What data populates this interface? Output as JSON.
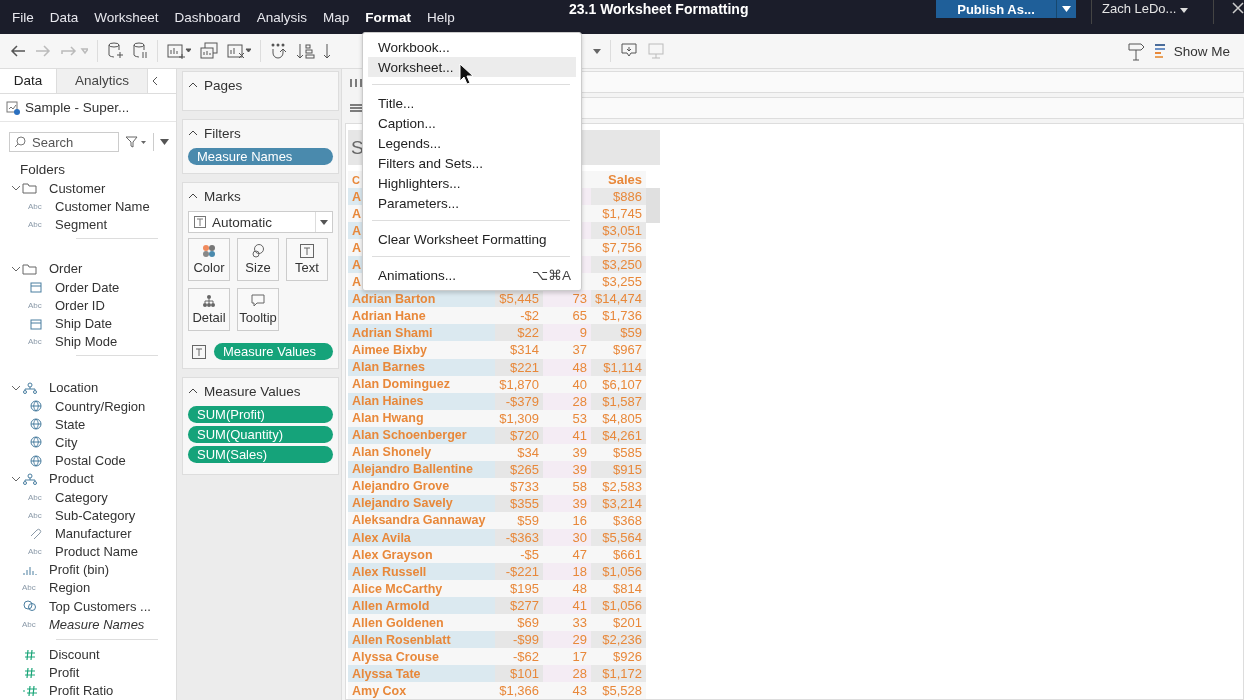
{
  "menu_bar": {
    "items": [
      {
        "label": "File",
        "selected": false
      },
      {
        "label": "Data",
        "selected": false
      },
      {
        "label": "Worksheet",
        "selected": false
      },
      {
        "label": "Dashboard",
        "selected": false
      },
      {
        "label": "Analysis",
        "selected": false
      },
      {
        "label": "Map",
        "selected": false
      },
      {
        "label": "Format",
        "selected": true
      },
      {
        "label": "Help",
        "selected": false
      }
    ],
    "title": "23.1 Worksheet Formatting",
    "publish_button": "Publish As...",
    "user": "Zach LeDo..."
  },
  "toolbar": {
    "show_me": "Show Me"
  },
  "data_pane": {
    "tabs": [
      {
        "label": "Data",
        "selected": true
      },
      {
        "label": "Analytics",
        "selected": false
      }
    ],
    "data_source": "Sample - Super...",
    "search": {
      "placeholder": "Search"
    },
    "folders_label": "Folders",
    "groups": [
      [
        {
          "label": "Customer",
          "kind": "folder",
          "expanded": true,
          "children": [
            {
              "label": "Customer Name",
              "kind": "string",
              "badge": "Abc"
            },
            {
              "label": "Segment",
              "kind": "string",
              "badge": "Abc"
            }
          ]
        }
      ],
      [
        {
          "label": "Order",
          "kind": "folder",
          "expanded": true,
          "children": [
            {
              "label": "Order Date",
              "kind": "date"
            },
            {
              "label": "Order ID",
              "kind": "string",
              "badge": "Abc"
            },
            {
              "label": "Ship Date",
              "kind": "date"
            },
            {
              "label": "Ship Mode",
              "kind": "string",
              "badge": "Abc"
            }
          ]
        }
      ],
      [
        {
          "label": "Location",
          "kind": "hierarchy",
          "expanded": true,
          "children": [
            {
              "label": "Country/Region",
              "kind": "geo"
            },
            {
              "label": "State",
              "kind": "geo"
            },
            {
              "label": "City",
              "kind": "geo"
            },
            {
              "label": "Postal Code",
              "kind": "geo"
            }
          ]
        },
        {
          "label": "Product",
          "kind": "hierarchy",
          "expanded": true,
          "children": [
            {
              "label": "Category",
              "kind": "string",
              "badge": "Abc"
            },
            {
              "label": "Sub-Category",
              "kind": "string",
              "badge": "Abc"
            },
            {
              "label": "Manufacturer",
              "kind": "group"
            },
            {
              "label": "Product Name",
              "kind": "string",
              "badge": "Abc"
            }
          ]
        },
        {
          "label": "Profit (bin)",
          "kind": "bin"
        },
        {
          "label": "Region",
          "kind": "string",
          "badge": "Abc"
        },
        {
          "label": "Top Customers ...",
          "kind": "set"
        },
        {
          "label": "Measure Names",
          "kind": "generated",
          "badge": "Abc"
        }
      ],
      [
        {
          "label": "Discount",
          "kind": "number"
        },
        {
          "label": "Profit",
          "kind": "number"
        },
        {
          "label": "Profit Ratio",
          "kind": "calc"
        }
      ]
    ]
  },
  "cards": {
    "pages": {
      "title": "Pages"
    },
    "filters": {
      "title": "Filters",
      "pills": [
        {
          "label": "Measure Names",
          "continuous": false
        }
      ]
    },
    "marks": {
      "title": "Marks",
      "mark_type": "Automatic",
      "buttons": [
        {
          "label": "Color",
          "kind": "color"
        },
        {
          "label": "Size",
          "kind": "size"
        },
        {
          "label": "Text",
          "kind": "text"
        },
        {
          "label": "Detail",
          "kind": "detail"
        },
        {
          "label": "Tooltip",
          "kind": "tooltip"
        }
      ],
      "pills": [
        {
          "label": "Measure Values",
          "continuous": true,
          "kind": "text"
        }
      ]
    },
    "measure_values": {
      "title": "Measure Values",
      "pills": [
        {
          "label": "SUM(Profit)",
          "continuous": true
        },
        {
          "label": "SUM(Quantity)",
          "continuous": true
        },
        {
          "label": "SUM(Sales)",
          "continuous": true
        }
      ]
    }
  },
  "view": {
    "title": "S",
    "header": {
      "name": "C",
      "sales": "Sales"
    },
    "rows": [
      {
        "name": "A",
        "sales": "$886"
      },
      {
        "name": "A",
        "sales": "$1,745"
      },
      {
        "name": "A",
        "sales": "$3,051"
      },
      {
        "name": "A",
        "sales": "$7,756"
      },
      {
        "name": "A",
        "sales": "$3,250"
      },
      {
        "name": "A",
        "sales": "$3,255"
      },
      {
        "name": "Adrian Barton",
        "profit": "$5,445",
        "quantity": "73",
        "sales": "$14,474"
      },
      {
        "name": "Adrian Hane",
        "profit": "-$2",
        "quantity": "65",
        "sales": "$1,736"
      },
      {
        "name": "Adrian Shami",
        "profit": "$22",
        "quantity": "9",
        "sales": "$59"
      },
      {
        "name": "Aimee Bixby",
        "profit": "$314",
        "quantity": "37",
        "sales": "$967"
      },
      {
        "name": "Alan Barnes",
        "profit": "$221",
        "quantity": "48",
        "sales": "$1,114"
      },
      {
        "name": "Alan Dominguez",
        "profit": "$1,870",
        "quantity": "40",
        "sales": "$6,107"
      },
      {
        "name": "Alan Haines",
        "profit": "-$379",
        "quantity": "28",
        "sales": "$1,587"
      },
      {
        "name": "Alan Hwang",
        "profit": "$1,309",
        "quantity": "53",
        "sales": "$4,805"
      },
      {
        "name": "Alan Schoenberger",
        "profit": "$720",
        "quantity": "41",
        "sales": "$4,261"
      },
      {
        "name": "Alan Shonely",
        "profit": "$34",
        "quantity": "39",
        "sales": "$585"
      },
      {
        "name": "Alejandro Ballentine",
        "profit": "$265",
        "quantity": "39",
        "sales": "$915"
      },
      {
        "name": "Alejandro Grove",
        "profit": "$733",
        "quantity": "58",
        "sales": "$2,583"
      },
      {
        "name": "Alejandro Savely",
        "profit": "$355",
        "quantity": "39",
        "sales": "$3,214"
      },
      {
        "name": "Aleksandra Gannaway",
        "profit": "$59",
        "quantity": "16",
        "sales": "$368"
      },
      {
        "name": "Alex Avila",
        "profit": "-$363",
        "quantity": "30",
        "sales": "$5,564"
      },
      {
        "name": "Alex Grayson",
        "profit": "-$5",
        "quantity": "47",
        "sales": "$661"
      },
      {
        "name": "Alex Russell",
        "profit": "-$221",
        "quantity": "18",
        "sales": "$1,056"
      },
      {
        "name": "Alice McCarthy",
        "profit": "$195",
        "quantity": "48",
        "sales": "$814"
      },
      {
        "name": "Allen Armold",
        "profit": "$277",
        "quantity": "41",
        "sales": "$1,056"
      },
      {
        "name": "Allen Goldenen",
        "profit": "$69",
        "quantity": "33",
        "sales": "$201"
      },
      {
        "name": "Allen Rosenblatt",
        "profit": "-$99",
        "quantity": "29",
        "sales": "$2,236"
      },
      {
        "name": "Alyssa Crouse",
        "profit": "-$62",
        "quantity": "17",
        "sales": "$926"
      },
      {
        "name": "Alyssa Tate",
        "profit": "$101",
        "quantity": "28",
        "sales": "$1,172"
      },
      {
        "name": "Amy Cox",
        "profit": "$1,366",
        "quantity": "43",
        "sales": "$5,528"
      }
    ]
  },
  "format_menu": {
    "items": [
      {
        "kind": "item",
        "label": "Workbook...",
        "selected": false
      },
      {
        "kind": "item",
        "label": "Worksheet...",
        "selected": true
      },
      {
        "kind": "separator"
      },
      {
        "kind": "item",
        "label": "Title...",
        "selected": false
      },
      {
        "kind": "item",
        "label": "Caption...",
        "selected": false
      },
      {
        "kind": "item",
        "label": "Legends...",
        "selected": false
      },
      {
        "kind": "item",
        "label": "Filters and Sets...",
        "selected": false
      },
      {
        "kind": "item",
        "label": "Highlighters...",
        "selected": false
      },
      {
        "kind": "item",
        "label": "Parameters...",
        "selected": false
      },
      {
        "kind": "separator"
      },
      {
        "kind": "item",
        "label": "Clear Worksheet Formatting",
        "selected": false
      },
      {
        "kind": "separator"
      },
      {
        "kind": "item",
        "label": "Animations...",
        "shortcut": "⌥⌘A",
        "selected": false
      }
    ]
  }
}
